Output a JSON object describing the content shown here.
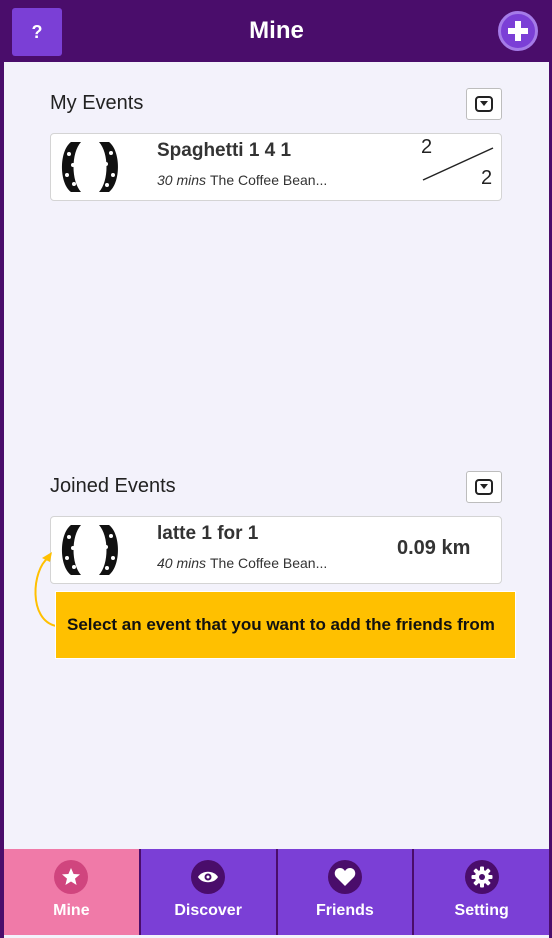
{
  "header": {
    "help_label": "?",
    "title": "Mine",
    "add_icon": "plus-icon"
  },
  "my_events": {
    "title": "My Events",
    "dropdown_icon": "chevron-down-icon",
    "items": [
      {
        "name": "Spaghetti 1 4 1",
        "duration": "30 mins",
        "location": "The Coffee Bean...",
        "count_top": "2",
        "count_bottom": "2"
      }
    ]
  },
  "joined_events": {
    "title": "Joined Events",
    "dropdown_icon": "chevron-down-icon",
    "items": [
      {
        "name": "latte 1 for 1",
        "duration": "40 mins",
        "location": "The Coffee Bean...",
        "distance": "0.09 km"
      }
    ]
  },
  "tooltip": {
    "text": "Select an event that you want to add the friends from"
  },
  "tabs": [
    {
      "label": "Mine",
      "icon": "star-icon",
      "active": true
    },
    {
      "label": "Discover",
      "icon": "eye-icon",
      "active": false
    },
    {
      "label": "Friends",
      "icon": "heart-icon",
      "active": false
    },
    {
      "label": "Setting",
      "icon": "gear-icon",
      "active": false
    }
  ],
  "colors": {
    "header_bg": "#4a0d6b",
    "accent_purple": "#7b3fd6",
    "active_tab": "#f07aa8",
    "callout_bg": "#ffc000",
    "page_bg": "#f3f2fb"
  }
}
